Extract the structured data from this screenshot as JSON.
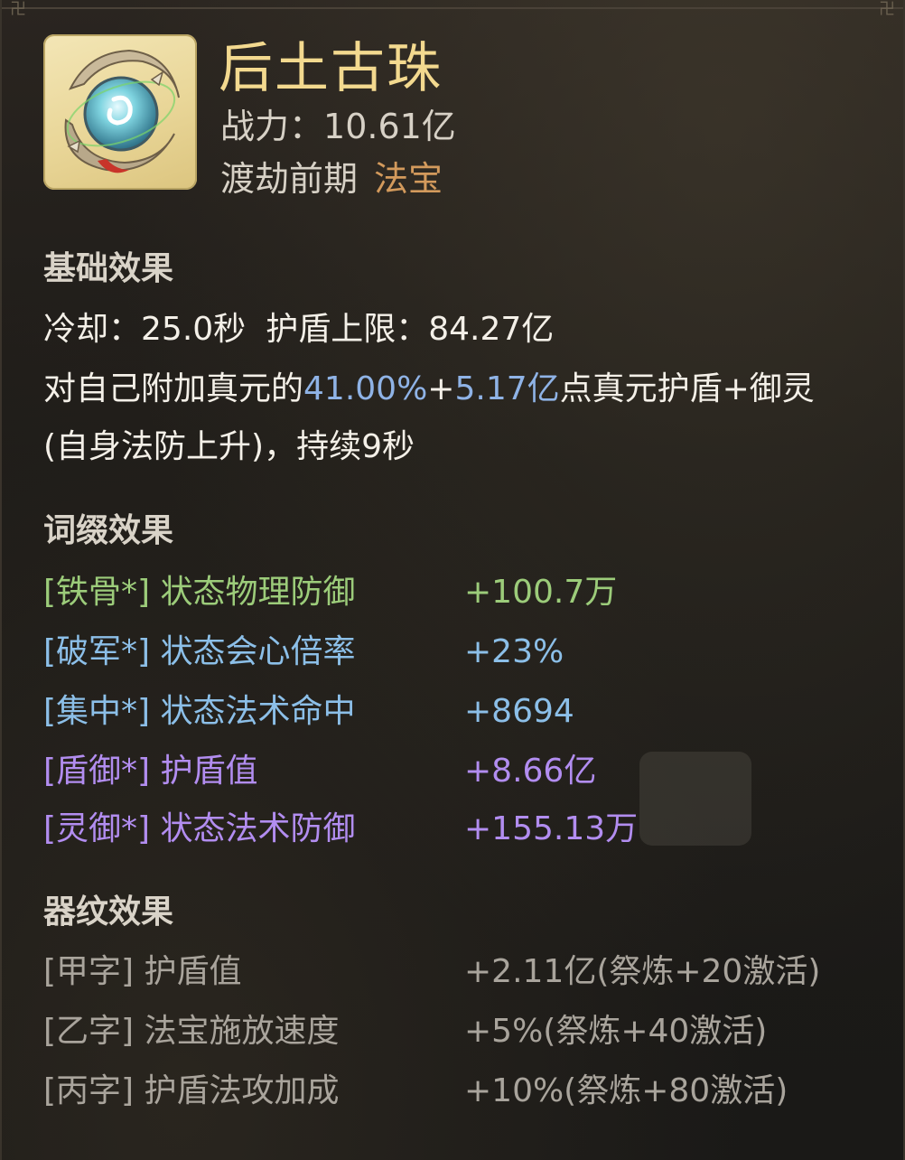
{
  "item": {
    "name": "后土古珠",
    "power_label": "战力：",
    "power_value": "10.61亿",
    "stage": "渡劫前期",
    "type": "法宝"
  },
  "base": {
    "title": "基础效果",
    "cooldown_label": "冷却：",
    "cooldown_value": "25.0秒",
    "shield_cap_label": "护盾上限：",
    "shield_cap_value": "84.27亿",
    "desc_part1": "对自己附加真元的",
    "desc_pct": "41.00%",
    "desc_plus": "+",
    "desc_amount": "5.17亿",
    "desc_part2": "点真元护盾+御灵",
    "desc_line2": "(自身法防上升)，持续9秒"
  },
  "affix": {
    "title": "词缀效果",
    "rows": [
      {
        "name": "[铁骨*] 状态物理防御",
        "value": "+100.7万",
        "color": "#9ccc7a"
      },
      {
        "name": "[破军*] 状态会心倍率",
        "value": "+23%",
        "color": "#8cbfe8"
      },
      {
        "name": "[集中*] 状态法术命中",
        "value": "+8694",
        "color": "#8cbfe8"
      },
      {
        "name": "[盾御*] 护盾值",
        "value": "+8.66亿",
        "color": "#b28df0"
      },
      {
        "name": "[灵御*] 状态法术防御",
        "value": "+155.13万",
        "color": "#b28df0"
      }
    ]
  },
  "pattern": {
    "title": "器纹效果",
    "rows": [
      {
        "name": "[甲字] 护盾值",
        "value": "+2.11亿(祭炼+20激活)"
      },
      {
        "name": "[乙字] 法宝施放速度",
        "value": "+5%(祭炼+40激活)"
      },
      {
        "name": "[丙字] 护盾法攻加成",
        "value": "+10%(祭炼+80激活)"
      }
    ]
  },
  "colors": {
    "title": "#f3d98f",
    "type": "#d39a5c",
    "highlight_blue": "#8fb3e6",
    "green": "#9ccc7a",
    "cyan": "#8cbfe8",
    "purple": "#b28df0",
    "grey": "#a9a49c"
  },
  "icons": {
    "item_icon": "spirit-orb-icon",
    "corner": "ornament-icon"
  }
}
